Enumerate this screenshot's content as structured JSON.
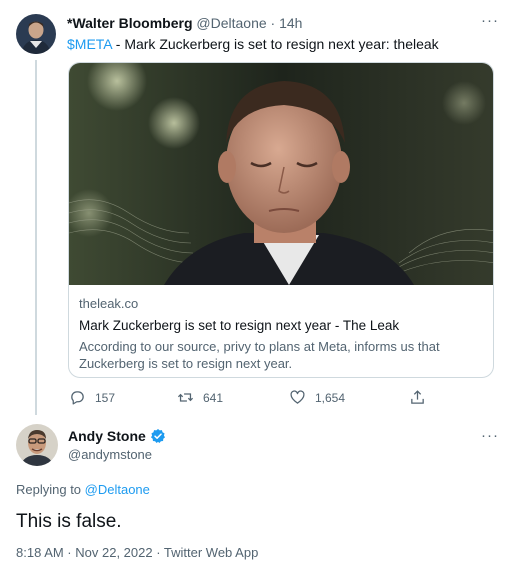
{
  "quoted_tweet": {
    "author_name": "*Walter Bloomberg",
    "author_handle": "@Deltaone",
    "separator": "·",
    "time": "14h",
    "cashtag": "$META",
    "text": " - Mark Zuckerberg is set to resign next year: theleak",
    "more_label": "···",
    "card": {
      "domain": "theleak.co",
      "title": "Mark Zuckerberg is set to resign next year - The Leak",
      "description": "According to our source, privy to plans at Meta, informs us that Zuckerberg is set to resign next year."
    },
    "actions": {
      "replies": "157",
      "retweets": "641",
      "likes": "1,654"
    }
  },
  "reply_tweet": {
    "author_name": "Andy Stone",
    "author_handle": "@andymstone",
    "more_label": "···",
    "replying_prefix": "Replying to ",
    "replying_to": "@Deltaone",
    "text": "This is false.",
    "meta": "8:18 AM · Nov 22, 2022 · Twitter Web App"
  },
  "colors": {
    "accent": "#1d9bf0",
    "secondary_text": "#536471",
    "border": "#cfd9de"
  },
  "icons": [
    "reply-icon",
    "retweet-icon",
    "like-icon",
    "share-icon",
    "verified-badge-icon"
  ]
}
